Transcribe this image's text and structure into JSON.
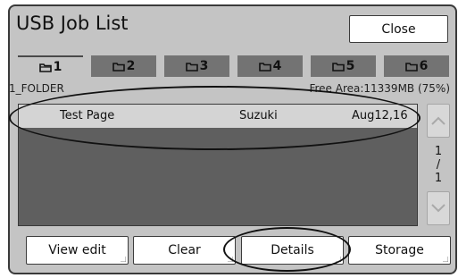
{
  "window": {
    "title": "USB Job List",
    "close_label": "Close"
  },
  "tabs": [
    {
      "label": "1",
      "active": true
    },
    {
      "label": "2",
      "active": false
    },
    {
      "label": "3",
      "active": false
    },
    {
      "label": "4",
      "active": false
    },
    {
      "label": "5",
      "active": false
    },
    {
      "label": "6",
      "active": false
    }
  ],
  "folder": {
    "name": "1_FOLDER",
    "free_area": "Free Area:11339MB (75%)"
  },
  "jobs": [
    {
      "name": "Test Page",
      "owner": "Suzuki",
      "date": "Aug12,16"
    }
  ],
  "pager": {
    "current": "1",
    "sep": "/",
    "total": "1"
  },
  "buttons": {
    "view_edit": "View edit",
    "clear": "Clear",
    "details": "Details",
    "storage": "Storage"
  },
  "colors": {
    "panel": "#c4c4c4",
    "list_bg": "#5f5f5f",
    "tab_inactive": "#737373",
    "row_bg": "#d4d4d4"
  },
  "icons": {
    "tab": "folder-icon",
    "scroll_up": "chevron-up-icon",
    "scroll_down": "chevron-down-icon"
  }
}
